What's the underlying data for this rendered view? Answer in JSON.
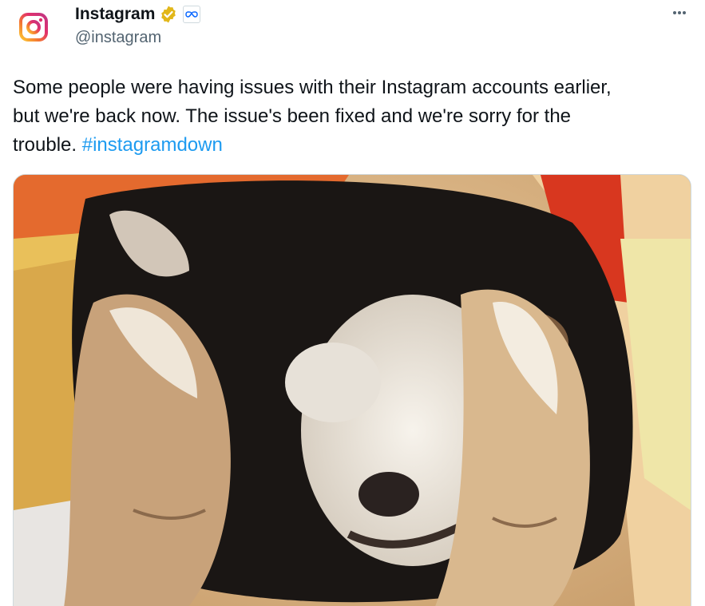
{
  "author": {
    "display_name": "Instagram",
    "handle": "@instagram",
    "avatar_icon": "instagram-logo-icon",
    "verified_icon": "gold-verified-badge-icon",
    "affiliation_icon": "meta-infinity-icon"
  },
  "tweet": {
    "text_lines": [
      "Some people were having issues with their Instagram accounts earlier,",
      "but we're back now. The issue's been fixed and we're sorry for the",
      "trouble. "
    ],
    "hashtag": "#instagramdown"
  },
  "media": {
    "type": "gif",
    "alt_icon": "dog-covering-face-image"
  },
  "colors": {
    "link": "#1d9bf0",
    "text": "#0f1419",
    "secondary": "#536471",
    "verified_gold": "#e2b719"
  }
}
